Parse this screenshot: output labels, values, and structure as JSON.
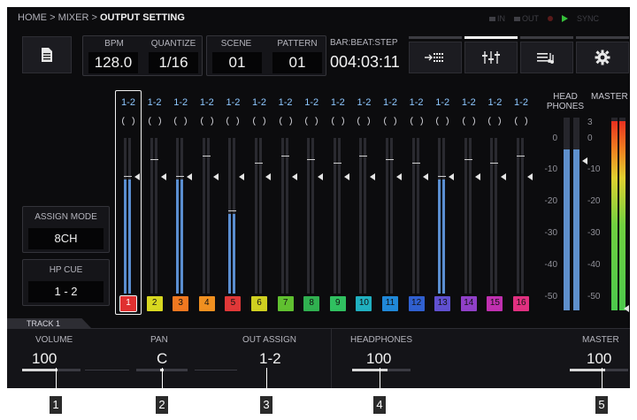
{
  "breadcrumb": {
    "home": "HOME",
    "sep1": ">",
    "mixer": "MIXER",
    "sep2": ">",
    "current": "OUTPUT SETTING"
  },
  "status": {
    "in": "IN",
    "out": "OUT",
    "sync": "SYNC"
  },
  "transport": {
    "bpm_label": "BPM",
    "bpm": "128.0",
    "quantize_label": "QUANTIZE",
    "quantize": "1/16",
    "scene_label": "SCENE",
    "scene": "01",
    "pattern_label": "PATTERN",
    "pattern": "01",
    "position_label": "BAR:BEAT:STEP",
    "position": "004:03:11"
  },
  "toolbar": {
    "icons": [
      "document-icon",
      "input-route-icon",
      "mixer-faders-icon",
      "sequence-icon",
      "gear-icon"
    ],
    "active_tab": 1
  },
  "left_panel": {
    "assign_mode_label": "ASSIGN MODE",
    "assign_mode": "8CH",
    "hp_cue_label": "HP CUE",
    "hp_cue": "1 - 2"
  },
  "channels": [
    {
      "num": "1",
      "out": "1-2",
      "level": 0.86,
      "color": "#e03030",
      "selected": true
    },
    {
      "num": "2",
      "out": "1-2",
      "level": 0.0,
      "color": "#d8d820"
    },
    {
      "num": "3",
      "out": "1-2",
      "level": 0.86,
      "color": "#f07820"
    },
    {
      "num": "4",
      "out": "1-2",
      "level": 0.0,
      "color": "#f09020"
    },
    {
      "num": "5",
      "out": "1-2",
      "level": 0.6,
      "color": "#e03838"
    },
    {
      "num": "6",
      "out": "1-2",
      "level": 0.0,
      "color": "#d0d020"
    },
    {
      "num": "7",
      "out": "1-2",
      "level": 0.0,
      "color": "#60c030"
    },
    {
      "num": "8",
      "out": "1-2",
      "level": 0.0,
      "color": "#30b050"
    },
    {
      "num": "9",
      "out": "1-2",
      "level": 0.0,
      "color": "#30c060"
    },
    {
      "num": "10",
      "out": "1-2",
      "level": 0.0,
      "color": "#20b0c0"
    },
    {
      "num": "11",
      "out": "1-2",
      "level": 0.0,
      "color": "#2088d8"
    },
    {
      "num": "12",
      "out": "1-2",
      "level": 0.0,
      "color": "#3060d0"
    },
    {
      "num": "13",
      "out": "1-2",
      "level": 0.86,
      "color": "#6050d0"
    },
    {
      "num": "14",
      "out": "1-2",
      "level": 0.0,
      "color": "#9040c8"
    },
    {
      "num": "15",
      "out": "1-2",
      "level": 0.0,
      "color": "#c030b0"
    },
    {
      "num": "16",
      "out": "1-2",
      "level": 0.0,
      "color": "#e03080"
    }
  ],
  "meters": {
    "headphones_label": "HEAD PHONES",
    "master_label": "MASTER",
    "scale": [
      "3",
      "0",
      "-10",
      "-20",
      "-30",
      "-40",
      "-50"
    ],
    "headphones_level": 0.93,
    "master_level": 0.98
  },
  "track": {
    "label": "TRACK 1"
  },
  "params": {
    "volume_label": "VOLUME",
    "volume": "100",
    "pan_label": "PAN",
    "pan": "C",
    "out_assign_label": "OUT ASSIGN",
    "out_assign": "1-2",
    "headphones_label": "HEADPHONES",
    "headphones": "100",
    "master_label": "MASTER",
    "master": "100"
  },
  "callouts": [
    "1",
    "2",
    "3",
    "4",
    "5"
  ]
}
